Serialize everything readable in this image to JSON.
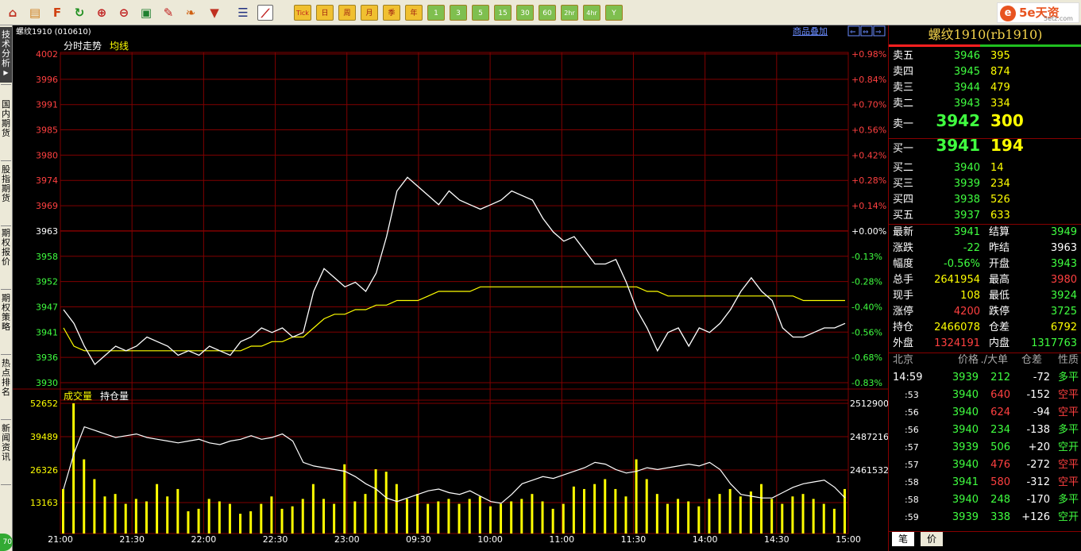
{
  "toolbar": {
    "icons": [
      "home-icon",
      "note-icon",
      "f10-icon",
      "refresh-icon",
      "zoom-in-icon",
      "zoom-out-icon",
      "window-icon",
      "pen-icon",
      "leaf-icon",
      "filter-icon",
      "table-icon",
      "line-chart-icon"
    ],
    "periods": [
      "Tick",
      "日",
      "周",
      "月",
      "季",
      "年",
      "1",
      "3",
      "5",
      "15",
      "30",
      "60",
      "2hr",
      "4hr",
      "Y"
    ]
  },
  "logo": {
    "mark": "e",
    "text": "5e天资",
    "sub": "5etz.com"
  },
  "left_tabs": [
    "技术分析",
    "国内期货",
    "股指期货",
    "期权报价",
    "期权策略",
    "热点排名",
    "新闻资讯"
  ],
  "green_ball": "70",
  "chart": {
    "symbol_line": "螺纹1910 (010610)",
    "overlay_link": "商品叠加",
    "price_title": "分时走势",
    "avg_title": "均线",
    "vol_title": "成交量",
    "oi_title": "持仓量",
    "price_ticks": [
      "4002",
      "3996",
      "3991",
      "3985",
      "3980",
      "3974",
      "3969",
      "3963",
      "3958",
      "3952",
      "3947",
      "3941",
      "3936",
      "3930"
    ],
    "pct_ticks": [
      "+0.98%",
      "+0.84%",
      "+0.70%",
      "+0.56%",
      "+0.42%",
      "+0.28%",
      "+0.14%",
      "+0.00%",
      "-0.13%",
      "-0.28%",
      "-0.40%",
      "-0.56%",
      "-0.68%",
      "-0.83%"
    ],
    "vol_ticks": [
      "52652",
      "39489",
      "26326",
      "13163"
    ],
    "oi_ticks": [
      "2512900",
      "2487216",
      "2461532"
    ],
    "time_ticks": [
      "21:00",
      "21:30",
      "22:00",
      "22:30",
      "23:00",
      "09:30",
      "10:00",
      "11:00",
      "11:30",
      "14:00",
      "14:30",
      "15:00"
    ],
    "colors": {
      "up": "#ff4040",
      "down": "#40ff40",
      "price": "#ffffff",
      "avg": "#ffff00",
      "grid": "#800000"
    }
  },
  "chart_data": {
    "type": "line",
    "title": "",
    "ylim": [
      3930,
      4002
    ],
    "prev_settle": 3963,
    "price": [
      3946,
      3943,
      3938,
      3934,
      3936,
      3938,
      3937,
      3938,
      3940,
      3939,
      3938,
      3936,
      3937,
      3936,
      3938,
      3937,
      3936,
      3939,
      3940,
      3942,
      3941,
      3942,
      3940,
      3941,
      3950,
      3955,
      3953,
      3951,
      3952,
      3950,
      3954,
      3962,
      3972,
      3975,
      3973,
      3971,
      3969,
      3972,
      3970,
      3969,
      3968,
      3969,
      3970,
      3972,
      3971,
      3970,
      3966,
      3963,
      3961,
      3962,
      3959,
      3956,
      3956,
      3957,
      3952,
      3946,
      3942,
      3937,
      3941,
      3942,
      3938,
      3942,
      3941,
      3943,
      3946,
      3950,
      3953,
      3950,
      3948,
      3942,
      3940,
      3940,
      3941,
      3942,
      3942,
      3943
    ],
    "avg": [
      3942,
      3938,
      3937,
      3937,
      3937,
      3937,
      3937,
      3937,
      3937,
      3937,
      3937,
      3937,
      3937,
      3937,
      3937,
      3937,
      3937,
      3937,
      3938,
      3938,
      3939,
      3939,
      3940,
      3940,
      3942,
      3944,
      3945,
      3945,
      3946,
      3946,
      3947,
      3947,
      3948,
      3948,
      3948,
      3949,
      3950,
      3950,
      3950,
      3950,
      3951,
      3951,
      3951,
      3951,
      3951,
      3951,
      3951,
      3951,
      3951,
      3951,
      3951,
      3951,
      3951,
      3951,
      3951,
      3951,
      3950,
      3950,
      3949,
      3949,
      3949,
      3949,
      3949,
      3949,
      3949,
      3949,
      3949,
      3949,
      3949,
      3949,
      3949,
      3948,
      3948,
      3948,
      3948,
      3948
    ],
    "volume_max": 52652,
    "volume": [
      18000,
      52652,
      30000,
      22000,
      15000,
      16000,
      12000,
      14000,
      13000,
      20000,
      15000,
      18000,
      9000,
      10000,
      14000,
      13000,
      12000,
      8000,
      9000,
      12000,
      15000,
      10000,
      11000,
      14000,
      20000,
      14000,
      12000,
      28000,
      13000,
      16000,
      26000,
      25000,
      20000,
      14000,
      16000,
      12000,
      13000,
      14000,
      12000,
      14000,
      15000,
      11000,
      12000,
      13000,
      14000,
      16000,
      13000,
      10000,
      12000,
      19000,
      18000,
      20000,
      22000,
      18000,
      15000,
      30000,
      22000,
      16000,
      12000,
      14000,
      13000,
      11000,
      14000,
      16000,
      18000,
      15000,
      17000,
      20000,
      14000,
      12000,
      15000,
      16000,
      14000,
      12000,
      10000,
      18000
    ],
    "open_interest": [
      2475000,
      2495000,
      2510000,
      2508000,
      2506000,
      2504000,
      2505000,
      2506000,
      2504000,
      2503000,
      2502000,
      2501000,
      2502000,
      2503000,
      2501000,
      2500000,
      2502000,
      2503000,
      2505000,
      2503000,
      2504000,
      2506000,
      2502000,
      2490000,
      2488000,
      2487000,
      2486000,
      2485000,
      2482000,
      2478000,
      2475000,
      2470000,
      2468000,
      2470000,
      2472000,
      2474000,
      2475000,
      2473000,
      2472000,
      2474000,
      2471000,
      2468000,
      2467000,
      2472000,
      2478000,
      2480000,
      2482000,
      2481000,
      2483000,
      2485000,
      2487000,
      2490000,
      2489000,
      2486000,
      2484000,
      2485000,
      2487000,
      2486000,
      2487000,
      2488000,
      2489000,
      2488000,
      2490000,
      2486000,
      2478000,
      2472000,
      2471000,
      2470000,
      2470000,
      2473000,
      2476000,
      2478000,
      2479000,
      2480000,
      2476000,
      2470000
    ],
    "oi_ylim": [
      2450000,
      2525000
    ]
  },
  "quote": {
    "title": "螺纹1910(rb1910)",
    "asks": [
      {
        "label": "卖五",
        "price": "3946",
        "vol": "395"
      },
      {
        "label": "卖四",
        "price": "3945",
        "vol": "874"
      },
      {
        "label": "卖三",
        "price": "3944",
        "vol": "479"
      },
      {
        "label": "卖二",
        "price": "3943",
        "vol": "334"
      },
      {
        "label": "卖一",
        "price": "3942",
        "vol": "300"
      }
    ],
    "bids": [
      {
        "label": "买一",
        "price": "3941",
        "vol": "194"
      },
      {
        "label": "买二",
        "price": "3940",
        "vol": "14"
      },
      {
        "label": "买三",
        "price": "3939",
        "vol": "234"
      },
      {
        "label": "买四",
        "price": "3938",
        "vol": "526"
      },
      {
        "label": "买五",
        "price": "3937",
        "vol": "633"
      }
    ],
    "stats": [
      {
        "l1": "最新",
        "v1": "3941",
        "c1": "#40ff40",
        "l2": "结算",
        "v2": "3949",
        "c2": "#40ff40"
      },
      {
        "l1": "涨跌",
        "v1": "-22",
        "c1": "#40ff40",
        "l2": "昨结",
        "v2": "3963",
        "c2": "#ffffff"
      },
      {
        "l1": "幅度",
        "v1": "-0.56%",
        "c1": "#40ff40",
        "l2": "开盘",
        "v2": "3943",
        "c2": "#40ff40"
      },
      {
        "l1": "总手",
        "v1": "2641954",
        "c1": "#ffff00",
        "l2": "最高",
        "v2": "3980",
        "c2": "#ff4040"
      },
      {
        "l1": "现手",
        "v1": "108",
        "c1": "#ffff00",
        "l2": "最低",
        "v2": "3924",
        "c2": "#40ff40"
      },
      {
        "l1": "涨停",
        "v1": "4200",
        "c1": "#ff4040",
        "l2": "跌停",
        "v2": "3725",
        "c2": "#40ff40"
      },
      {
        "l1": "持仓",
        "v1": "2466078",
        "c1": "#ffff00",
        "l2": "仓差",
        "v2": "6792",
        "c2": "#ffff00"
      },
      {
        "l1": "外盘",
        "v1": "1324191",
        "c1": "#ff4040",
        "l2": "内盘",
        "v2": "1317763",
        "c2": "#40ff40"
      }
    ],
    "ticks_header": {
      "place": "北京",
      "price": "价格",
      "vol": "./大单",
      "diff": "仓差",
      "nature": "性质"
    },
    "ticks": [
      {
        "time": "14:59",
        "price": "3939",
        "vol": "212",
        "vc": "#40ff40",
        "diff": "-72",
        "nature": "多平",
        "nc": "#40ff40"
      },
      {
        "time": ":53",
        "price": "3940",
        "vol": "640",
        "vc": "#ff4040",
        "diff": "-152",
        "nature": "空平",
        "nc": "#ff4040"
      },
      {
        "time": ":56",
        "price": "3940",
        "vol": "624",
        "vc": "#ff4040",
        "diff": "-94",
        "nature": "空平",
        "nc": "#ff4040"
      },
      {
        "time": ":56",
        "price": "3940",
        "vol": "234",
        "vc": "#40ff40",
        "diff": "-138",
        "nature": "多平",
        "nc": "#40ff40"
      },
      {
        "time": ":57",
        "price": "3939",
        "vol": "506",
        "vc": "#40ff40",
        "diff": "+20",
        "nature": "空开",
        "nc": "#40ff40"
      },
      {
        "time": ":57",
        "price": "3940",
        "vol": "476",
        "vc": "#ff4040",
        "diff": "-272",
        "nature": "空平",
        "nc": "#ff4040"
      },
      {
        "time": ":58",
        "price": "3941",
        "vol": "580",
        "vc": "#ff4040",
        "diff": "-312",
        "nature": "空平",
        "nc": "#ff4040"
      },
      {
        "time": ":58",
        "price": "3940",
        "vol": "248",
        "vc": "#40ff40",
        "diff": "-170",
        "nature": "多平",
        "nc": "#40ff40"
      },
      {
        "time": ":59",
        "price": "3939",
        "vol": "338",
        "vc": "#40ff40",
        "diff": "+126",
        "nature": "空开",
        "nc": "#40ff40"
      }
    ],
    "bottom_tabs": [
      "笔",
      "价"
    ]
  }
}
